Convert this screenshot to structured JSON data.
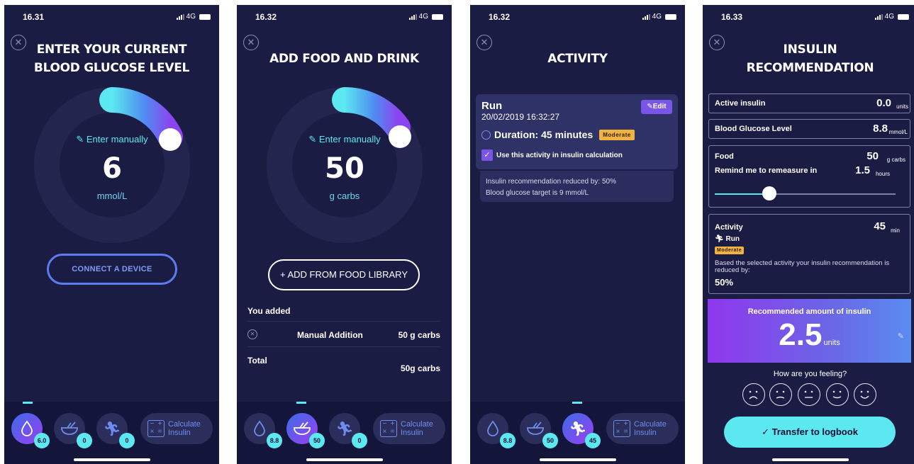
{
  "screens": [
    {
      "time": "16.31",
      "network": "4G",
      "title": "ENTER YOUR CURRENT BLOOD GLUCOSE LEVEL",
      "enter_manually": "Enter manually",
      "value": "6",
      "unit": "mmol/L",
      "connect_button": "CONNECT A DEVICE",
      "tabs": {
        "glucose_badge": "6.0",
        "food_badge": "0",
        "activity_badge": "0",
        "calc_label_1": "Calculate",
        "calc_label_2": "Insulin"
      }
    },
    {
      "time": "16.32",
      "network": "4G",
      "title": "ADD FOOD AND DRINK",
      "enter_manually": "Enter manually",
      "value": "50",
      "unit": "g carbs",
      "add_button": "+ ADD FROM FOOD LIBRARY",
      "you_added": "You added",
      "items": [
        {
          "name": "Manual Addition",
          "amount": "50 g carbs"
        }
      ],
      "total_label": "Total",
      "total_value": "50g carbs",
      "tabs": {
        "glucose_badge": "8.8",
        "food_badge": "50",
        "activity_badge": "0",
        "calc_label_1": "Calculate",
        "calc_label_2": "Insulin"
      }
    },
    {
      "time": "16.32",
      "network": "4G",
      "title": "ACTIVITY",
      "activity_name": "Run",
      "activity_datetime": "20/02/2019 16:32:27",
      "edit_label": "Edit",
      "duration": "Duration: 45 minutes",
      "intensity": "Moderate",
      "checkbox_label": "Use this activity in insulin calculation",
      "info_1": "Insulin recommendation reduced by: 50%",
      "info_2": "Blood glucose target is 9 mmol/L",
      "tabs": {
        "glucose_badge": "8.8",
        "food_badge": "50",
        "activity_badge": "45",
        "calc_label_1": "Calculate",
        "calc_label_2": "Insulin"
      }
    },
    {
      "time": "16.33",
      "network": "4G",
      "title": "INSULIN RECOMMENDATION",
      "active_insulin": {
        "label": "Active insulin",
        "value": "0.0",
        "unit": "units"
      },
      "bgl": {
        "label": "Blood Glucose Level",
        "value": "8.8",
        "unit": "mmol/L"
      },
      "food": {
        "label": "Food",
        "value": "50",
        "unit": "g carbs"
      },
      "remind": {
        "label": "Remind me to remeasure in",
        "value": "1.5",
        "unit": "hours"
      },
      "remind_slider_fraction": 0.3,
      "activity": {
        "label": "Activity",
        "value": "45",
        "unit": "min",
        "name": "Run",
        "intensity": "Moderate",
        "description": "Based the selected activity your insulin recommendation is reduced by:",
        "reduction": "50%"
      },
      "recommended_title": "Recommended amount of insulin",
      "recommended_value": "2.5",
      "recommended_unit": "units",
      "feeling_question": "How are you feeling?",
      "transfer_button": "Transfer to logbook"
    }
  ]
}
